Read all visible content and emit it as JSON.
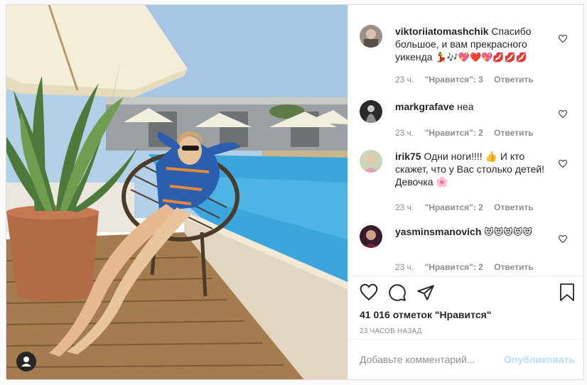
{
  "post": {
    "user_tag_icon": "user-icon",
    "photo": "woman-lounging-by-pool"
  },
  "comments": [
    {
      "username": "viktoriiatomashchik",
      "text": "Спасибо большое, и вам прекрасного уикенда",
      "emoji": "💃🎶💖❤️💖💋💋💋",
      "age": "23 ч.",
      "likes": "\"Нравится\": 3",
      "reply": "Ответить"
    },
    {
      "username": "markgrafave",
      "text": "неа",
      "emoji": "",
      "age": "23 ч.",
      "likes": "\"Нравится\": 2",
      "reply": "Ответить"
    },
    {
      "username": "irik75",
      "text": "Одни ноги!!!! 👍 И кто скажет, что у Вас столько детей! Девочка 🌸",
      "emoji": "",
      "age": "23 ч.",
      "likes": "\"Нравится\": 2",
      "reply": "Ответить"
    },
    {
      "username": "yasminsmanovich",
      "text": "",
      "emoji": "😻😻😻😻😻",
      "age": "23 ч.",
      "likes": "\"Нравится\": 2",
      "reply": "Ответить"
    }
  ],
  "actions": {
    "likes_count": "41 016 отметок \"Нравится\"",
    "posted_time": "23 ЧАСОВ НАЗАД"
  },
  "composer": {
    "placeholder": "Добавьте комментарий...",
    "publish_label": "Опубликовать"
  }
}
